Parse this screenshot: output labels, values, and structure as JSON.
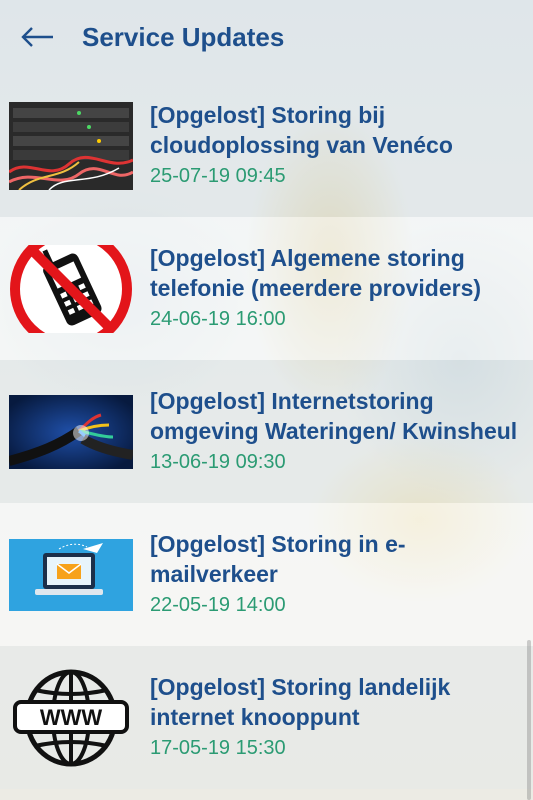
{
  "header": {
    "title": "Service Updates",
    "back_icon": "arrow-left-icon"
  },
  "colors": {
    "title": "#1e4f8c",
    "date": "#2b9b73"
  },
  "items": [
    {
      "headline": "[Opgelost] Storing bij cloudoplossing van  Venéco",
      "date": "25-07-19 09:45",
      "thumbnail": "server-rack-image"
    },
    {
      "headline": "[Opgelost] Algemene storing telefonie (meerdere providers)",
      "date": "24-06-19 16:00",
      "thumbnail": "no-phone-icon"
    },
    {
      "headline": "[Opgelost] Internetstoring omgeving Wateringen/ Kwinsheul",
      "date": "13-06-19 09:30",
      "thumbnail": "cable-wires-image"
    },
    {
      "headline": "[Opgelost] Storing in e-mailverkeer",
      "date": "22-05-19 14:00",
      "thumbnail": "laptop-email-image"
    },
    {
      "headline": "[Opgelost] Storing landelijk internet knooppunt",
      "date": "17-05-19 15:30",
      "thumbnail": "www-globe-icon"
    }
  ]
}
